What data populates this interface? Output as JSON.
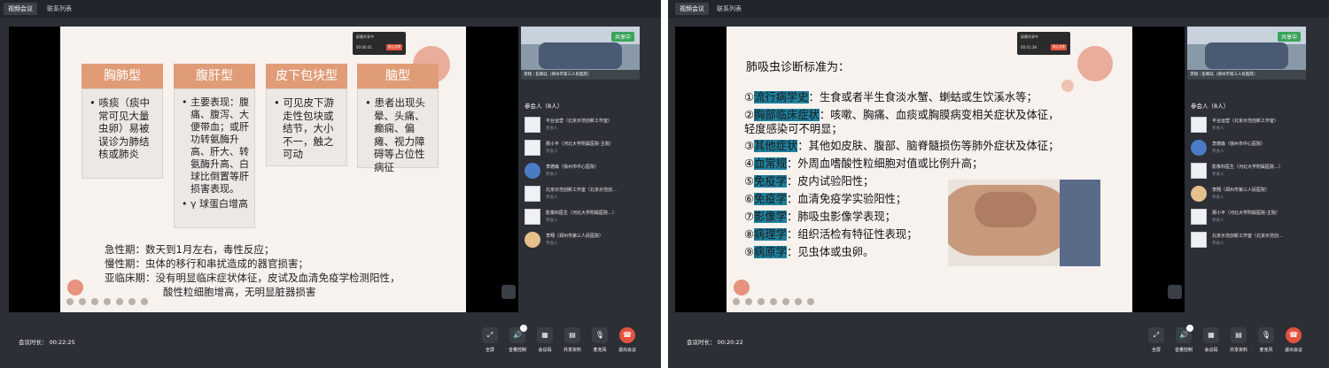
{
  "colors": {
    "accent_orange": "#e09c77",
    "leave_red": "#e2533f",
    "share_green": "#3aa35a",
    "highlight_teal": "#1f7f9c"
  },
  "windows": [
    {
      "tabs": [
        "视频会议",
        "联系列表"
      ],
      "popup": {
        "line1": "屏幕共享中",
        "line2": "00:00:41",
        "button": "停止共享"
      },
      "slide": {
        "cards": [
          {
            "title": "胸肺型",
            "bullets": [
              "咳痰（痰中常可见大量虫卵）易被误诊为肺结核或肺炎"
            ]
          },
          {
            "title": "腹肝型",
            "bullets": [
              "主要表现：腹痛、腹泻、大便带血；或肝功转氨酶升高、肝大、转氨酶升高、白球比倒置等肝损害表现。",
              "γ 球蛋白增高"
            ]
          },
          {
            "title": "皮下包块型",
            "bullets": [
              "可见皮下游走性包块或结节，大小不一，触之可动"
            ]
          },
          {
            "title": "脑型",
            "bullets": [
              "患者出现头晕、头痛、癫痫、偏瘫、视力障碍等占位性病征"
            ]
          }
        ],
        "phases": [
          "急性期：数天到1月左右，毒性反应；",
          "慢性期：虫体的移行和串扰造成的器官损害；",
          "亚临床期：没有明显临床症状体征，皮试及血清免疫学检测阳性，",
          "酸性粒细胞增高，无明显脏器损害"
        ]
      },
      "thumb": {
        "share": "共享中",
        "caption": "李翔｜彭卿兵（郑州市第三人民医院）"
      },
      "participants_label": "参会人（8人）",
      "participants": [
        {
          "name": "平台运营（北京示范创新工作室）",
          "status": "参会人"
        },
        {
          "name": "那小平（河北大学附属医院-主院）",
          "status": "参会人"
        },
        {
          "name": "李德森（徐州市中心医院）",
          "status": "参会人"
        },
        {
          "name": "北京示范创新工作室（北京示范创…",
          "status": "参会人"
        },
        {
          "name": "影像科医生（河北大学附属医院…）",
          "status": "参会人"
        },
        {
          "name": "李翔（郑州市第三人民医院）",
          "status": "参会人"
        }
      ],
      "timer": "会议时长：  00:22:25",
      "controls": [
        "全屏",
        "音量控制",
        "会议码",
        "共享资料",
        "麦克风",
        "退出会议"
      ]
    },
    {
      "tabs": [
        "视频会议",
        "联系列表"
      ],
      "popup": {
        "line1": "屏幕共享中",
        "line2": "00:01:38",
        "button": "停止共享"
      },
      "slide": {
        "title": "肺吸虫诊断标准为：",
        "criteria": [
          {
            "num": "①",
            "label": "流行病学史",
            "text": "：生食或者半生食淡水蟹、蝲蛄或生饮溪水等；"
          },
          {
            "num": "②",
            "label": "胸部临床症状",
            "text": "：咳嗽、胸痛、血痰或胸膜病变相关症状及体征，"
          },
          {
            "num": "",
            "label": "",
            "text": "轻度感染可不明显；"
          },
          {
            "num": "③",
            "label": "其他症状",
            "text": "：其他如皮肤、腹部、脑脊髓损伤等肺外症状及体征；"
          },
          {
            "num": "④",
            "label": "血常规",
            "text": "：外周血嗜酸性粒细胞对值或比例升高；"
          },
          {
            "num": "⑤",
            "label": "免疫学",
            "text": "：皮内试验阳性；"
          },
          {
            "num": "⑥",
            "label": "免疫学",
            "text": "：血清免疫学实验阳性；"
          },
          {
            "num": "⑦",
            "label": "影像学",
            "text": "：肺吸虫影像学表现；"
          },
          {
            "num": "⑧",
            "label": "病理学",
            "text": "：组织活检有特征性表现；"
          },
          {
            "num": "⑨",
            "label": "病原学",
            "text": "：见虫体或虫卵。"
          }
        ]
      },
      "thumb": {
        "share": "共享中",
        "caption": "李翔｜彭卿兵（郑州市第三人民医院）"
      },
      "participants_label": "参会人（8人）",
      "participants": [
        {
          "name": "平台运营（北京示范创新工作室）",
          "status": "参会人"
        },
        {
          "name": "李德森（徐州市中心医院）",
          "status": "参会人"
        },
        {
          "name": "影像科医生（河北大学附属医院…）",
          "status": "参会人"
        },
        {
          "name": "李翔（郑州市第三人民医院）",
          "status": "参会人"
        },
        {
          "name": "那小平（河北大学附属医院-主院）",
          "status": "参会人"
        },
        {
          "name": "北京示范创新工作室（北京示范创…",
          "status": "参会人"
        }
      ],
      "timer": "会议时长：  00:20:22",
      "controls": [
        "全屏",
        "音量控制",
        "会议码",
        "共享资料",
        "麦克风",
        "退出会议"
      ]
    }
  ]
}
